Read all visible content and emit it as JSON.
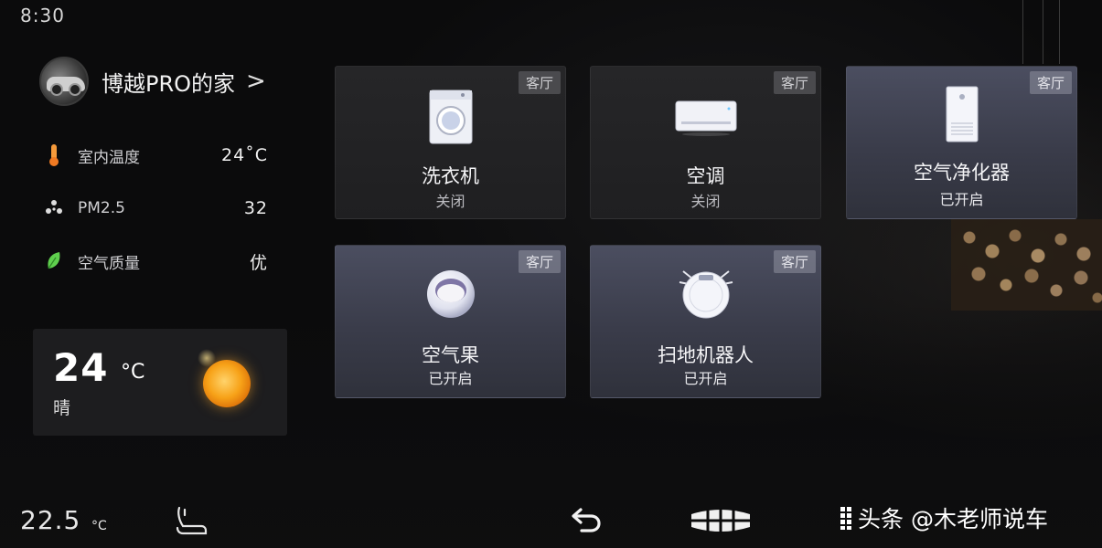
{
  "status_bar": {
    "time": "8:30"
  },
  "home": {
    "name": "博越PRO的家",
    "chevron": ">"
  },
  "environment": [
    {
      "icon": "thermometer-icon",
      "label": "室内温度",
      "value": "24˚C"
    },
    {
      "icon": "pm25-icon",
      "label": "PM2.5",
      "value": "32"
    },
    {
      "icon": "leaf-icon",
      "label": "空气质量",
      "value": "优"
    }
  ],
  "weather": {
    "temp": "24",
    "unit": "°C",
    "condition": "晴",
    "icon": "sun-icon"
  },
  "devices": [
    {
      "name": "洗衣机",
      "status": "关闭",
      "room": "客厅",
      "on": false,
      "icon": "washing-machine-icon"
    },
    {
      "name": "空调",
      "status": "关闭",
      "room": "客厅",
      "on": false,
      "icon": "air-conditioner-icon"
    },
    {
      "name": "空气净化器",
      "status": "已开启",
      "room": "客厅",
      "on": true,
      "icon": "air-purifier-icon"
    },
    {
      "name": "空气果",
      "status": "已开启",
      "room": "客厅",
      "on": true,
      "icon": "air-fruit-icon"
    },
    {
      "name": "扫地机器人",
      "status": "已开启",
      "room": "客厅",
      "on": true,
      "icon": "robot-vacuum-icon"
    }
  ],
  "bottom_bar": {
    "cabin_temp": "22.5",
    "cabin_temp_unit": "°C",
    "watermark": "头条 @木老师说车"
  }
}
